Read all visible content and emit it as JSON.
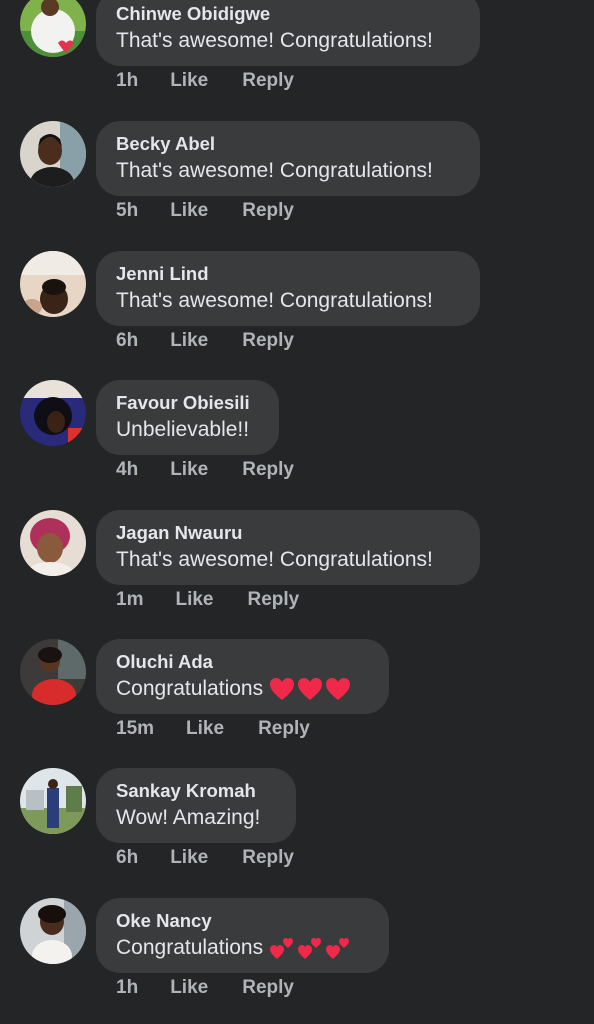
{
  "comments": [
    {
      "author": "Chinwe Obidigwe",
      "text": "That's awesome! Congratulations!",
      "time": "1h",
      "like": "Like",
      "reply": "Reply",
      "avatar": "person-in-white-shirt-photo",
      "hearts": 0
    },
    {
      "author": "Becky Abel",
      "text": "That's awesome! Congratulations!",
      "time": "5h",
      "like": "Like",
      "reply": "Reply",
      "avatar": "woman-portrait-photo",
      "hearts": 0
    },
    {
      "author": "Jenni Lind",
      "text": "That's awesome! Congratulations!",
      "time": "6h",
      "like": "Like",
      "reply": "Reply",
      "avatar": "woman-selfie-photo",
      "hearts": 0
    },
    {
      "author": "Favour Obiesili",
      "text": "Unbelievable!!",
      "time": "4h",
      "like": "Like",
      "reply": "Reply",
      "avatar": "woman-with-afro-photo",
      "hearts": 0
    },
    {
      "author": "Jagan Nwauru",
      "text": "That's awesome! Congratulations!",
      "time": "1m",
      "like": "Like",
      "reply": "Reply",
      "avatar": "woman-with-red-hair-photo",
      "hearts": 0
    },
    {
      "author": "Oluchi Ada",
      "text": "Congratulations",
      "time": "15m",
      "like": "Like",
      "reply": "Reply",
      "avatar": "woman-in-red-dress-photo",
      "hearts": 3,
      "heart_style": "red-heart"
    },
    {
      "author": "Sankay Kromah",
      "text": "Wow! Amazing!",
      "time": "6h",
      "like": "Like",
      "reply": "Reply",
      "avatar": "person-outdoors-photo",
      "hearts": 0
    },
    {
      "author": "Oke Nancy",
      "text": "Congratulations",
      "time": "1h",
      "like": "Like",
      "reply": "Reply",
      "avatar": "woman-in-white-photo",
      "hearts": 3,
      "heart_style": "two-hearts"
    }
  ],
  "colors": {
    "background": "#242526",
    "bubble": "#3a3b3c",
    "text": "#e4e6eb",
    "secondary_text": "#b0b3b8",
    "heart": "#f0284a"
  }
}
